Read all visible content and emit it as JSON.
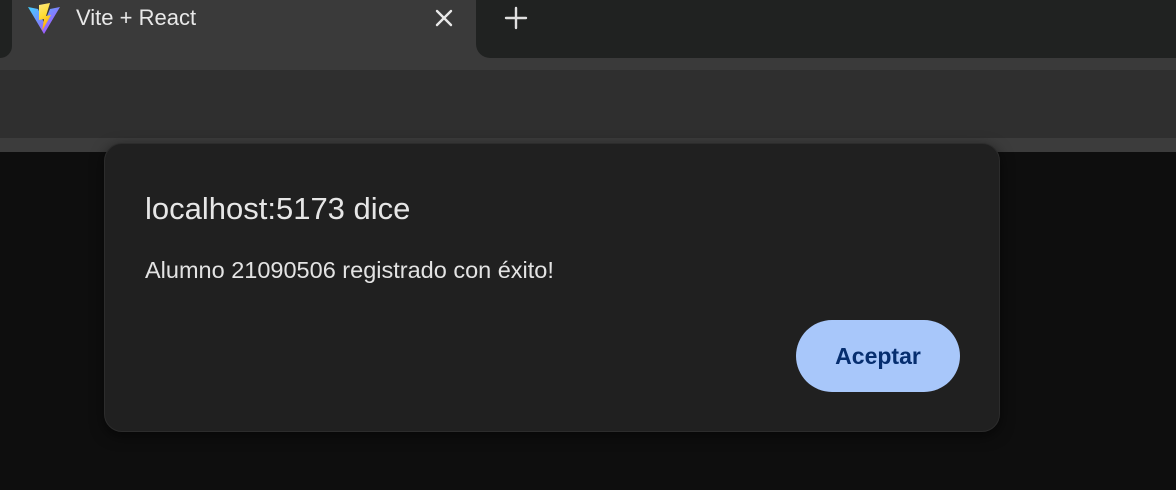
{
  "browser": {
    "tab": {
      "title": "Vite + React",
      "favicon": "vite-logo-icon",
      "close_icon": "close-icon"
    },
    "new_tab_icon": "plus-icon"
  },
  "dialog": {
    "title": "localhost:5173 dice",
    "message": "Alumno 21090506 registrado con éxito!",
    "accept_label": "Aceptar"
  },
  "colors": {
    "accent_button": "#a8c7fa",
    "accent_button_text": "#062e6f",
    "dialog_background": "#202020",
    "page_background": "#0e0e0e"
  }
}
